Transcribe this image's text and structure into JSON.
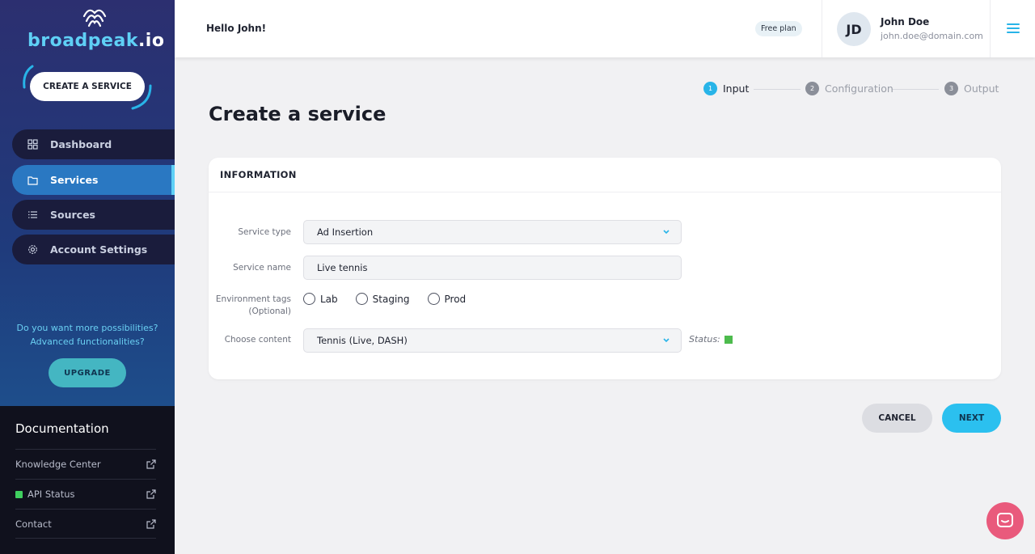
{
  "brand": {
    "logo_main": "broadpeak",
    "logo_suffix": ".io",
    "accent": "#5fd0f6",
    "logo_icon": "waves-icon"
  },
  "sidebar": {
    "create_label": "CREATE A SERVICE",
    "nav": [
      {
        "label": "Dashboard",
        "icon": "grid-icon",
        "active": false
      },
      {
        "label": "Services",
        "icon": "folder-icon",
        "active": true
      },
      {
        "label": "Sources",
        "icon": "list-icon",
        "active": false
      },
      {
        "label": "Account Settings",
        "icon": "gear-icon",
        "active": false
      }
    ],
    "promo_line1": "Do you want more possibilities?",
    "promo_line2": "Advanced functionalities?",
    "upgrade_label": "UPGRADE",
    "docs": {
      "title": "Documentation",
      "links": [
        {
          "label": "Knowledge Center",
          "icon": "external-link-icon"
        },
        {
          "label": "API Status",
          "icon": "external-link-icon",
          "status_color": "#3fcf5f"
        },
        {
          "label": "Contact",
          "icon": "external-link-icon"
        }
      ]
    }
  },
  "header": {
    "greeting": "Hello John!",
    "plan": "Free plan",
    "user": {
      "initials": "JD",
      "name": "John Doe",
      "email": "john.doe@domain.com"
    },
    "menu_icon": "hamburger-icon"
  },
  "stepper": [
    {
      "num": "1",
      "label": "Input",
      "active": true
    },
    {
      "num": "2",
      "label": "Configuration",
      "active": false
    },
    {
      "num": "3",
      "label": "Output",
      "active": false
    }
  ],
  "page": {
    "title": "Create a service"
  },
  "form": {
    "section_title": "INFORMATION",
    "service_type": {
      "label": "Service type",
      "value": "Ad Insertion"
    },
    "service_name": {
      "label": "Service name",
      "value": "Live tennis"
    },
    "env_tags": {
      "label": "Environment tags",
      "sublabel": "(Optional)",
      "options": [
        "Lab",
        "Staging",
        "Prod"
      ]
    },
    "content": {
      "label": "Choose content",
      "value": "Tennis (Live, DASH)"
    },
    "status_label": "Status:",
    "status_color": "#4dbb4d"
  },
  "actions": {
    "cancel": "CANCEL",
    "next": "NEXT"
  },
  "chat": {
    "icon": "chat-icon",
    "color": "#e95a7c"
  }
}
